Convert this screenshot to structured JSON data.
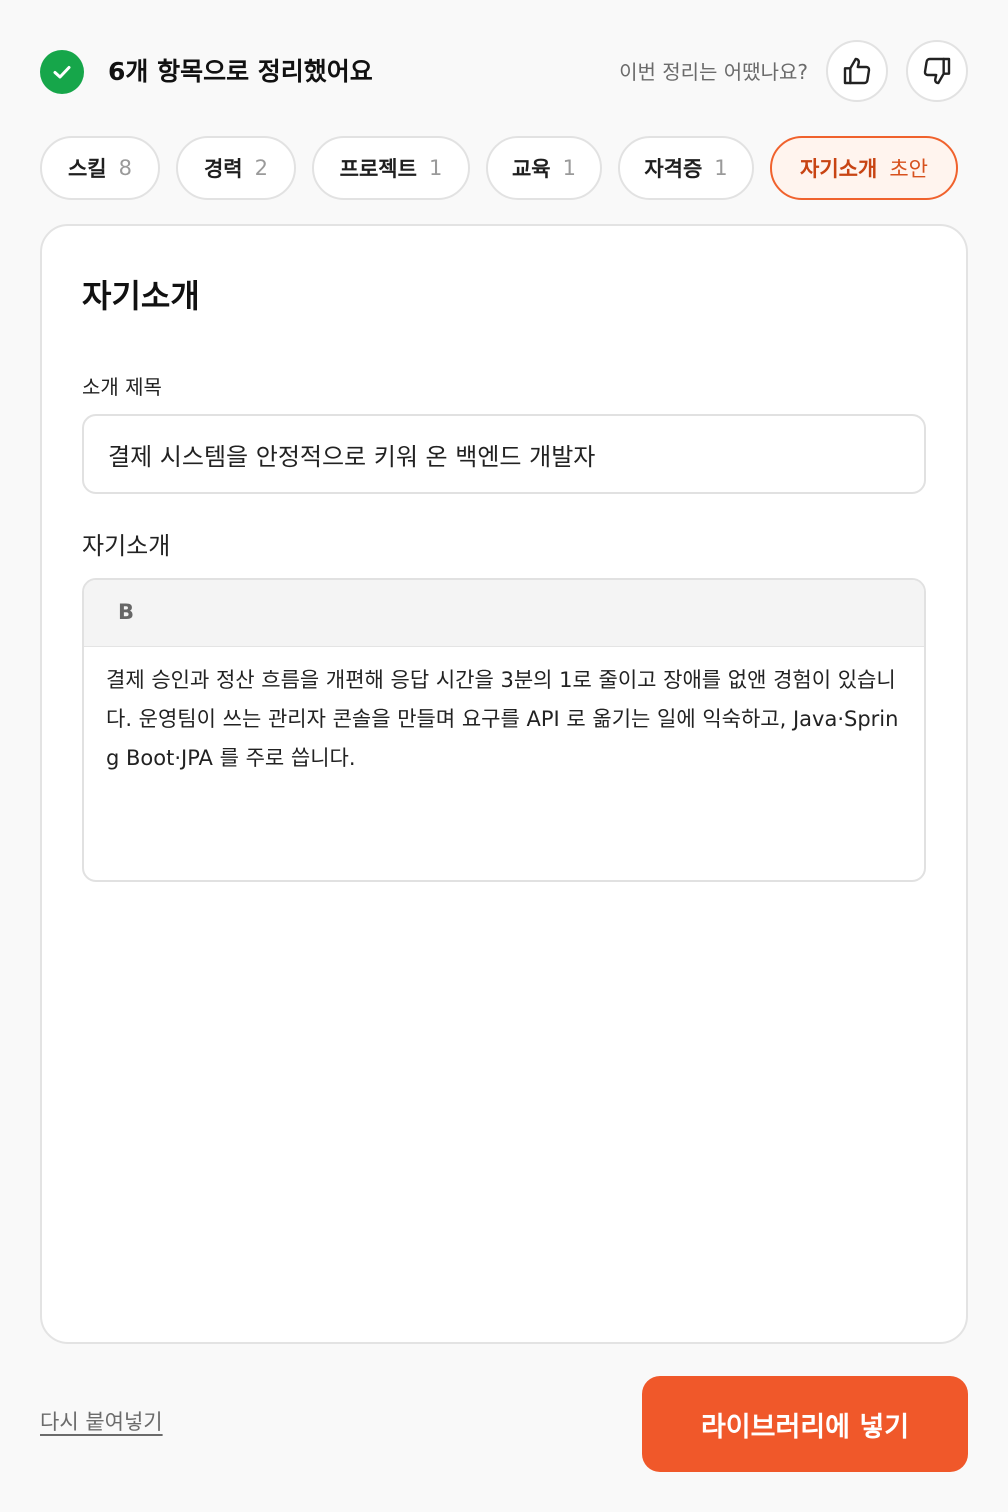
{
  "header": {
    "status_title": "6개 항목으로 정리했어요",
    "status_icon": "check-circle-icon",
    "status_color": "#16a64a",
    "feedback_question": "이번 정리는 어땠나요?",
    "thumbs_up_icon": "thumbs-up-icon",
    "thumbs_down_icon": "thumbs-down-icon"
  },
  "tabs": [
    {
      "label": "스킬",
      "count": "8",
      "active": false
    },
    {
      "label": "경력",
      "count": "2",
      "active": false
    },
    {
      "label": "프로젝트",
      "count": "1",
      "active": false
    },
    {
      "label": "교육",
      "count": "1",
      "active": false
    },
    {
      "label": "자격증",
      "count": "1",
      "active": false
    },
    {
      "label": "자기소개",
      "count": "초안",
      "active": true
    }
  ],
  "card": {
    "title": "자기소개",
    "intro_title_label": "소개 제목",
    "intro_title_value": "결제 시스템을 안정적으로 키워 온 백엔드 개발자",
    "intro_label": "자기소개",
    "bold_button_label": "B",
    "intro_body": "결제 승인과 정산 흐름을 개편해 응답 시간을 3분의 1로 줄이고 장애를 없앤 경험이 있습니다. 운영팀이 쓰는 관리자 콘솔을 만들며 요구를 API 로 옮기는 일에 익숙하고, Java·Spring Boot·JPA 를 주로 씁니다."
  },
  "footer": {
    "repaste_label": "다시 붙여넣기",
    "primary_label": "라이브러리에 넣기",
    "accent_color": "#f0582a"
  }
}
